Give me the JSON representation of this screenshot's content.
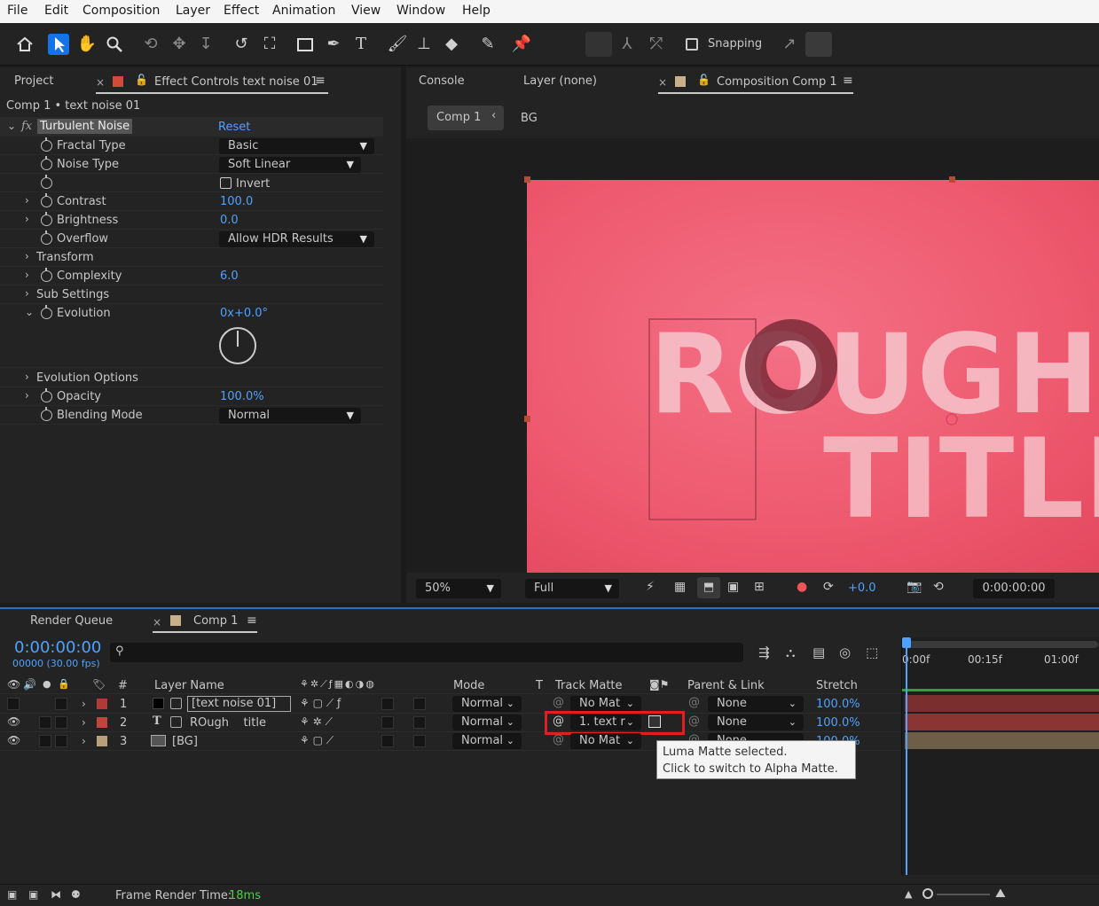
{
  "menu": [
    "File",
    "Edit",
    "Composition",
    "Layer",
    "Effect",
    "Animation",
    "View",
    "Window",
    "Help"
  ],
  "toolbar": {
    "snapping_label": "Snapping"
  },
  "left_panel": {
    "tab_project": "Project",
    "tab_effect_controls": "Effect Controls text noise 01",
    "breadcrumb": "Comp 1 • text noise 01",
    "effect_name": "Turbulent Noise",
    "reset": "Reset",
    "props": [
      {
        "label": "Fractal Type",
        "value": "Basic"
      },
      {
        "label": "Noise Type",
        "value": "Soft Linear"
      },
      {
        "label": "",
        "value": "Invert"
      },
      {
        "label": "Contrast",
        "value": "100.0"
      },
      {
        "label": "Brightness",
        "value": "0.0"
      },
      {
        "label": "Overflow",
        "value": "Allow HDR Results"
      },
      {
        "label": "Transform",
        "value": ""
      },
      {
        "label": "Complexity",
        "value": "6.0"
      },
      {
        "label": "Sub Settings",
        "value": ""
      },
      {
        "label": "Evolution",
        "value": "0x+0.0°"
      },
      {
        "label": "Evolution Options",
        "value": ""
      },
      {
        "label": "Opacity",
        "value": "100.0%"
      },
      {
        "label": "Blending Mode",
        "value": "Normal"
      }
    ]
  },
  "viewer": {
    "tab_console": "Console",
    "tab_layer": "Layer (none)",
    "tab_composition": "Composition Comp 1",
    "crumb_comp": "Comp 1",
    "crumb_bg": "BG",
    "title_line1": "ROUGH",
    "title_line2": "TITLE",
    "zoom": "50%",
    "resolution": "Full",
    "exposure": "+0.0",
    "timecode": "0:00:00:00",
    "bg_color": "#f0596e"
  },
  "timeline": {
    "tab_render_queue": "Render Queue",
    "tab_comp": "Comp 1",
    "current_time": "0:00:00:00",
    "frame_info": "00000 (30.00 fps)",
    "search_placeholder": "",
    "headers": {
      "num": "#",
      "layer_name": "Layer Name",
      "mode": "Mode",
      "t": "T",
      "track_matte": "Track Matte",
      "parent": "Parent & Link",
      "stretch": "Stretch"
    },
    "ruler": [
      "0:00f",
      "00:15f",
      "01:00f"
    ],
    "layers": [
      {
        "num": "1",
        "name": "[text noise 01]",
        "mode": "Normal",
        "matte": "No Mat",
        "parent": "None",
        "stretch": "100.0%",
        "color": "#b03a3a"
      },
      {
        "num": "2",
        "name": "ROugh    title",
        "mode": "Normal",
        "matte": "1. text r",
        "parent": "None",
        "stretch": "100.0%",
        "color": "#c0453a"
      },
      {
        "num": "3",
        "name": "[BG]",
        "mode": "Normal",
        "matte": "No Mat",
        "parent": "None",
        "stretch": "100.0%",
        "color": "#b8a07a"
      }
    ],
    "tooltip_line1": "Luma Matte selected.",
    "tooltip_line2": "Click to switch to Alpha Matte.",
    "footer_label": "Frame Render Time:",
    "footer_value": "18ms"
  }
}
